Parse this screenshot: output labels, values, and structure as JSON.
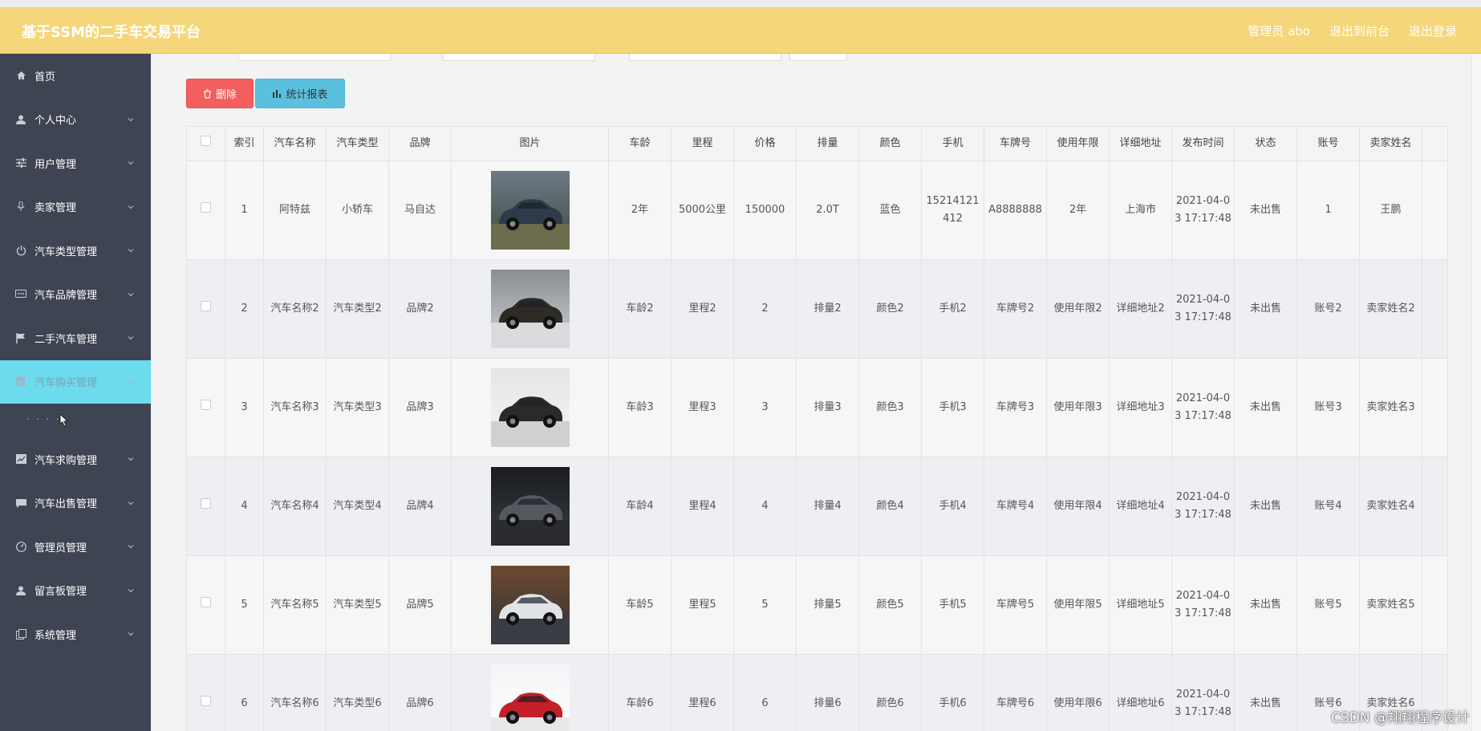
{
  "app": {
    "title": "基于SSM的二手车交易平台",
    "user_label": "管理员 abo",
    "to_front": "退出到前台",
    "logout": "退出登录"
  },
  "colors": {
    "header_bg": "#f5d67a",
    "sidebar_bg": "#3e4452",
    "sidebar_active": "#6cdbee",
    "delete_btn": "#f35f5f",
    "report_btn": "#5bc0de"
  },
  "sidebar": {
    "items": [
      {
        "label": "首页",
        "icon": "home-icon",
        "expandable": false
      },
      {
        "label": "个人中心",
        "icon": "user-icon",
        "expandable": true
      },
      {
        "label": "用户管理",
        "icon": "sliders-icon",
        "expandable": true
      },
      {
        "label": "卖家管理",
        "icon": "microphone-icon",
        "expandable": true
      },
      {
        "label": "汽车类型管理",
        "icon": "power-icon",
        "expandable": true
      },
      {
        "label": "汽车品牌管理",
        "icon": "comment-icon",
        "expandable": true
      },
      {
        "label": "二手汽车管理",
        "icon": "flag-icon",
        "expandable": true
      },
      {
        "label": "汽车购买管理",
        "icon": "clipboard-icon",
        "expandable": true,
        "active": true
      },
      {
        "label": "汽车求购管理",
        "icon": "chart-icon",
        "expandable": true
      },
      {
        "label": "汽车出售管理",
        "icon": "chat-icon",
        "expandable": true
      },
      {
        "label": "管理员管理",
        "icon": "dashboard-icon",
        "expandable": true
      },
      {
        "label": "留言板管理",
        "icon": "user-icon",
        "expandable": true
      },
      {
        "label": "系统管理",
        "icon": "copy-icon",
        "expandable": true
      }
    ],
    "submenu_text": "· · · ·"
  },
  "toolbar": {
    "delete_label": "删除",
    "report_label": "统计报表"
  },
  "table": {
    "headers": [
      "索引",
      "汽车名称",
      "汽车类型",
      "品牌",
      "图片",
      "车龄",
      "里程",
      "价格",
      "排量",
      "颜色",
      "手机",
      "车牌号",
      "使用年限",
      "详细地址",
      "发布时间",
      "状态",
      "账号",
      "卖家姓名"
    ],
    "rows": [
      {
        "idx": "1",
        "name": "阿特兹",
        "type": "小轿车",
        "brand": "马自达",
        "image": "car-dark-sedan",
        "age": "2年",
        "mileage": "5000公里",
        "price": "150000",
        "displacement": "2.0T",
        "color": "蓝色",
        "phone": "15214121412",
        "plate": "A8888888",
        "years": "2年",
        "address": "上海市",
        "time": "2021-04-03 17:17:48",
        "status": "未出售",
        "account": "1",
        "seller": "王鹏"
      },
      {
        "idx": "2",
        "name": "汽车名称2",
        "type": "汽车类型2",
        "brand": "品牌2",
        "image": "car-showroom",
        "age": "车龄2",
        "mileage": "里程2",
        "price": "2",
        "displacement": "排量2",
        "color": "颜色2",
        "phone": "手机2",
        "plate": "车牌号2",
        "years": "使用年限2",
        "address": "详细地址2",
        "time": "2021-04-03 17:17:48",
        "status": "未出售",
        "account": "账号2",
        "seller": "卖家姓名2"
      },
      {
        "idx": "3",
        "name": "汽车名称3",
        "type": "汽车类型3",
        "brand": "品牌3",
        "image": "car-supercar",
        "age": "车龄3",
        "mileage": "里程3",
        "price": "3",
        "displacement": "排量3",
        "color": "颜色3",
        "phone": "手机3",
        "plate": "车牌号3",
        "years": "使用年限3",
        "address": "详细地址3",
        "time": "2021-04-03 17:17:48",
        "status": "未出售",
        "account": "账号3",
        "seller": "卖家姓名3"
      },
      {
        "idx": "4",
        "name": "汽车名称4",
        "type": "汽车类型4",
        "brand": "品牌4",
        "image": "car-dark-coupe",
        "age": "车龄4",
        "mileage": "里程4",
        "price": "4",
        "displacement": "排量4",
        "color": "颜色4",
        "phone": "手机4",
        "plate": "车牌号4",
        "years": "使用年限4",
        "address": "详细地址4",
        "time": "2021-04-03 17:17:48",
        "status": "未出售",
        "account": "账号4",
        "seller": "卖家姓名4"
      },
      {
        "idx": "5",
        "name": "汽车名称5",
        "type": "汽车类型5",
        "brand": "品牌5",
        "image": "car-white-sedan",
        "age": "车龄5",
        "mileage": "里程5",
        "price": "5",
        "displacement": "排量5",
        "color": "颜色5",
        "phone": "手机5",
        "plate": "车牌号5",
        "years": "使用年限5",
        "address": "详细地址5",
        "time": "2021-04-03 17:17:48",
        "status": "未出售",
        "account": "账号5",
        "seller": "卖家姓名5"
      },
      {
        "idx": "6",
        "name": "汽车名称6",
        "type": "汽车类型6",
        "brand": "品牌6",
        "image": "car-red-suv",
        "age": "车龄6",
        "mileage": "里程6",
        "price": "6",
        "displacement": "排量6",
        "color": "颜色6",
        "phone": "手机6",
        "plate": "车牌号6",
        "years": "使用年限6",
        "address": "详细地址6",
        "time": "2021-04-03 17:17:48",
        "status": "未出售",
        "account": "账号6",
        "seller": "卖家姓名6"
      }
    ]
  },
  "watermark": "CSDN @翔翔程序设计"
}
